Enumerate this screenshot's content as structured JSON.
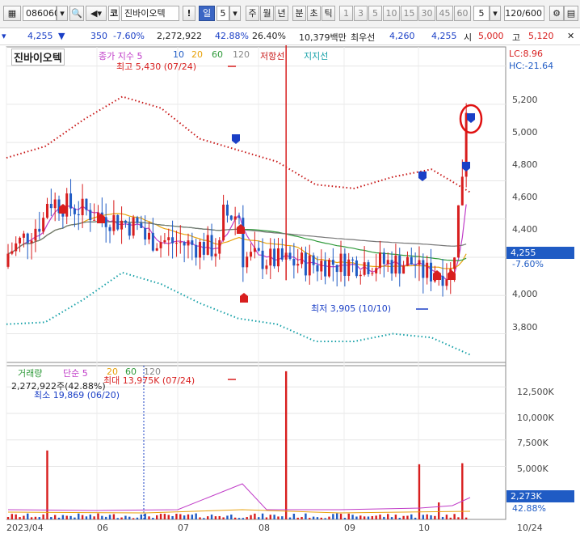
{
  "toolbar": {
    "code": "086060",
    "market_label": "코",
    "name": "진바이오텍",
    "interval_day": "일",
    "interval_num": "5",
    "periods": [
      "주",
      "월",
      "년"
    ],
    "minute_tabs": [
      "분",
      "초",
      "틱"
    ],
    "minute_values": [
      "1",
      "3",
      "5",
      "10",
      "15",
      "30",
      "45",
      "60"
    ],
    "minute_select": "5",
    "count": "120",
    "count_total": "/600"
  },
  "info": {
    "price": "4,255",
    "change": "350",
    "rate": "-7.60%",
    "volume": "2,272,922",
    "vol_ratio": "42.88%",
    "turnover": "26.40%",
    "amount": "10,379백만",
    "best_bid_label": "최우선",
    "bid": "4,260",
    "ask": "4,255",
    "open_label": "시",
    "open": "5,000",
    "high_label": "고",
    "high": "5,120",
    "close_icon": "close-icon"
  },
  "price_chart": {
    "title": "진바이오텍",
    "legend_ma": "종가 지수 5",
    "ma_periods": [
      "10",
      "20",
      "60",
      "120"
    ],
    "resistance": "저항선",
    "support": "지지선",
    "lc": "LC:8.96",
    "hc": "HC:-21.64",
    "high_annot": "최고 5,430 (07/24)",
    "low_annot": "최저 3,905 (10/10)",
    "current_price": "4,255",
    "current_rate": "-7.60%",
    "y_ticks": [
      "5,200",
      "5,000",
      "4,800",
      "4,600",
      "4,400",
      "4,000",
      "3,800"
    ]
  },
  "volume_chart": {
    "legend": "거래량",
    "legend_ma": "단순 5",
    "ma_periods": [
      "20",
      "60",
      "120"
    ],
    "vol_text": "2,272,922주(42.88%)",
    "max_annot": "최대 13,975K (07/24)",
    "min_annot": "최소 19,869 (06/20)",
    "y_ticks": [
      "12,500K",
      "10,000K",
      "7,500K",
      "5,000K"
    ],
    "current_vol": "2,273K",
    "current_rate": "42.88%"
  },
  "x_axis": [
    "2023/04",
    "06",
    "07",
    "08",
    "09",
    "10",
    "10/24"
  ],
  "chart_data": {
    "type": "candlestick",
    "title": "진바이오텍",
    "price_axis": {
      "ylim": [
        3650,
        5300
      ],
      "ticks": [
        3800,
        4000,
        4200,
        4400,
        4600,
        4800,
        5000,
        5200
      ]
    },
    "series": [
      {
        "name": "종가",
        "last": 4255,
        "high_marker": 5430,
        "low_marker": 3905
      },
      {
        "name": "저항선",
        "values": [
          4720,
          4780,
          4920,
          5040,
          4980,
          4820,
          4760,
          4700,
          4580,
          4560,
          4620,
          4660,
          4540
        ]
      },
      {
        "name": "지지선",
        "values": [
          3850,
          3860,
          3980,
          4120,
          4060,
          3960,
          3880,
          3850,
          3760,
          3760,
          3800,
          3780,
          3690
        ]
      }
    ],
    "volume_axis": {
      "ylim": [
        0,
        14500
      ],
      "unit": "K",
      "ticks": [
        5000,
        7500,
        10000,
        12500
      ]
    },
    "volume": {
      "max": 13975,
      "last": 2273
    },
    "colors": {
      "up": "#d81e1e",
      "down": "#1f5bc4",
      "resistance": "#c81818",
      "support": "#17a1a8",
      "ma5": "#c03cc8",
      "ma20": "#e8a20c",
      "ma60": "#2f9a3a",
      "ma120": "#777777"
    }
  }
}
